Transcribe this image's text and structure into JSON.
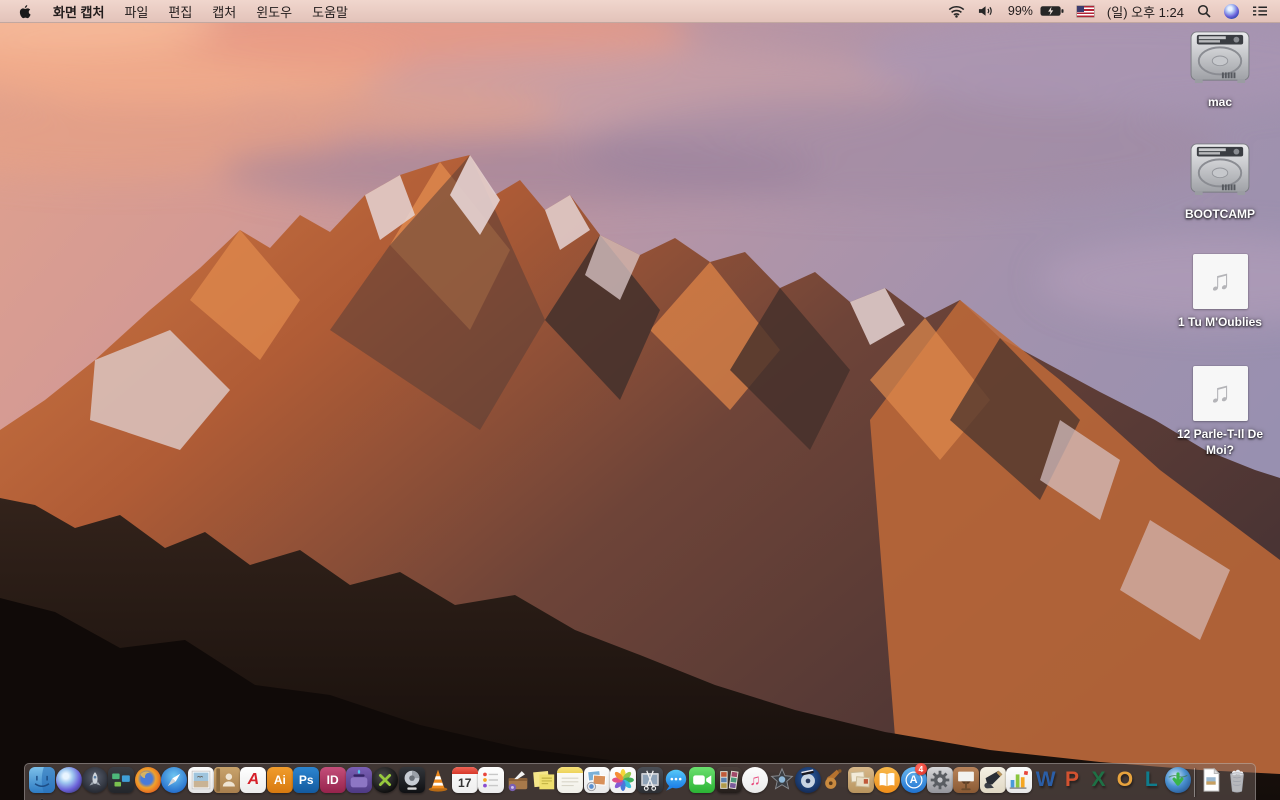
{
  "menubar": {
    "apple_icon": "apple-logo-icon",
    "app_name": "화면 캡처",
    "menus": [
      "파일",
      "편집",
      "캡처",
      "윈도우",
      "도움말"
    ],
    "status": {
      "battery_percent": "99%",
      "clock": "(일) 오후 1:24",
      "icons": [
        "wifi-icon",
        "volume-icon",
        "battery-charging-icon",
        "keyboard-layout-us-flag-icon",
        "spotlight-search-icon",
        "siri-icon",
        "notification-center-icon"
      ]
    }
  },
  "desktop": {
    "icons": [
      {
        "name": "mac-volume",
        "label": "mac",
        "type": "drive"
      },
      {
        "name": "bootcamp-volume",
        "label": "BOOTCAMP",
        "type": "drive"
      },
      {
        "name": "audio-file-1",
        "label": "1 Tu M'Oublies",
        "type": "audio",
        "glyph": "♫"
      },
      {
        "name": "audio-file-2",
        "label": "12 Parle-T-Il De Moi?",
        "type": "audio",
        "glyph": "♫"
      }
    ]
  },
  "dock": {
    "items": [
      {
        "name": "finder",
        "running": true
      },
      {
        "name": "siri"
      },
      {
        "name": "launchpad"
      },
      {
        "name": "mission-control"
      },
      {
        "name": "firefox"
      },
      {
        "name": "safari"
      },
      {
        "name": "preview"
      },
      {
        "name": "contacts"
      },
      {
        "name": "acrobat-reader",
        "glyph": "A"
      },
      {
        "name": "illustrator",
        "glyph": "Ai"
      },
      {
        "name": "photoshop",
        "glyph": "Ps"
      },
      {
        "name": "indesign",
        "glyph": "ID"
      },
      {
        "name": "toast"
      },
      {
        "name": "divx"
      },
      {
        "name": "disk-tool"
      },
      {
        "name": "vlc"
      },
      {
        "name": "calendar",
        "glyph": "17"
      },
      {
        "name": "reminders"
      },
      {
        "name": "drop-box"
      },
      {
        "name": "stickies"
      },
      {
        "name": "notes"
      },
      {
        "name": "image-capture"
      },
      {
        "name": "photos"
      },
      {
        "name": "grab",
        "running": true
      },
      {
        "name": "messages"
      },
      {
        "name": "facetime"
      },
      {
        "name": "photo-booth"
      },
      {
        "name": "itunes",
        "glyph": "♫"
      },
      {
        "name": "imovie"
      },
      {
        "name": "idvd"
      },
      {
        "name": "garageband"
      },
      {
        "name": "mail-stationery"
      },
      {
        "name": "ibooks"
      },
      {
        "name": "app-store",
        "glyph": "A",
        "badge": "4"
      },
      {
        "name": "system-preferences"
      },
      {
        "name": "keynote"
      },
      {
        "name": "pages"
      },
      {
        "name": "numbers"
      },
      {
        "name": "word",
        "glyph": "W"
      },
      {
        "name": "powerpoint",
        "glyph": "P"
      },
      {
        "name": "excel",
        "glyph": "X"
      },
      {
        "name": "outlook",
        "glyph": "O"
      },
      {
        "name": "lync",
        "glyph": "L"
      },
      {
        "name": "downloads-globe"
      },
      {
        "name": "separator",
        "separator": true
      },
      {
        "name": "document-file"
      },
      {
        "name": "trash"
      }
    ]
  }
}
